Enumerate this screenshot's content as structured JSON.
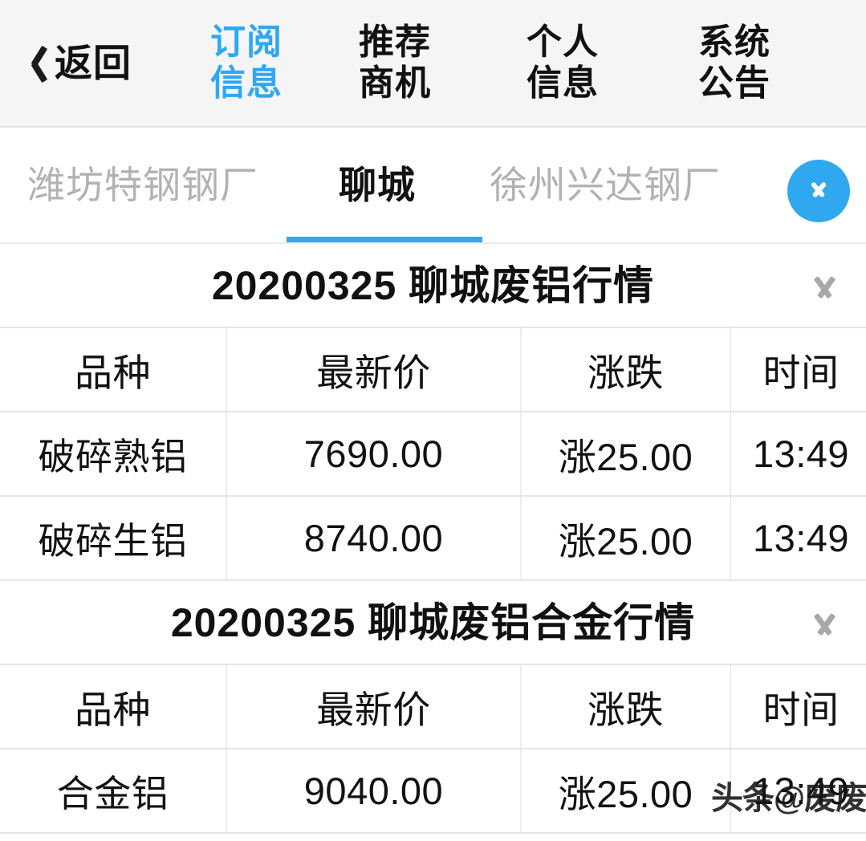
{
  "topnav": {
    "back": {
      "label": "返回",
      "icon": "chevron-left-icon"
    },
    "items": [
      {
        "line1": "订阅",
        "line2": "信息",
        "active": true
      },
      {
        "line1": "推荐",
        "line2": "商机",
        "active": false
      },
      {
        "line1": "个人",
        "line2": "信息",
        "active": false
      },
      {
        "line1": "系统",
        "line2": "公告",
        "active": false
      }
    ]
  },
  "tabbar": {
    "tabs": [
      {
        "label": "潍坊特钢钢厂",
        "active": false
      },
      {
        "label": "聊城",
        "active": true
      },
      {
        "label": "徐州兴达钢厂",
        "active": false
      }
    ],
    "expand_icon": "chevron-down-icon"
  },
  "sections": [
    {
      "title": "20200325 聊城废铝行情",
      "collapse_icon": "chevron-down-icon",
      "headers": [
        "品种",
        "最新价",
        "涨跌",
        "时间"
      ],
      "rows": [
        {
          "variety": "破碎熟铝",
          "price": "7690.00",
          "change": "涨25.00",
          "time": "13:49"
        },
        {
          "variety": "破碎生铝",
          "price": "8740.00",
          "change": "涨25.00",
          "time": "13:49"
        }
      ]
    },
    {
      "title": "20200325 聊城废铝合金行情",
      "collapse_icon": "chevron-down-icon",
      "headers": [
        "品种",
        "最新价",
        "涨跌",
        "时间"
      ],
      "rows": [
        {
          "variety": "合金铝",
          "price": "9040.00",
          "change": "涨25.00",
          "time": "13:49"
        }
      ]
    }
  ],
  "watermark": "头条@废废",
  "colors": {
    "accent": "#30a8ef",
    "up": "#d62222",
    "nav_bg": "#f5f5f5",
    "inactive_tab": "#b2b2b2"
  }
}
